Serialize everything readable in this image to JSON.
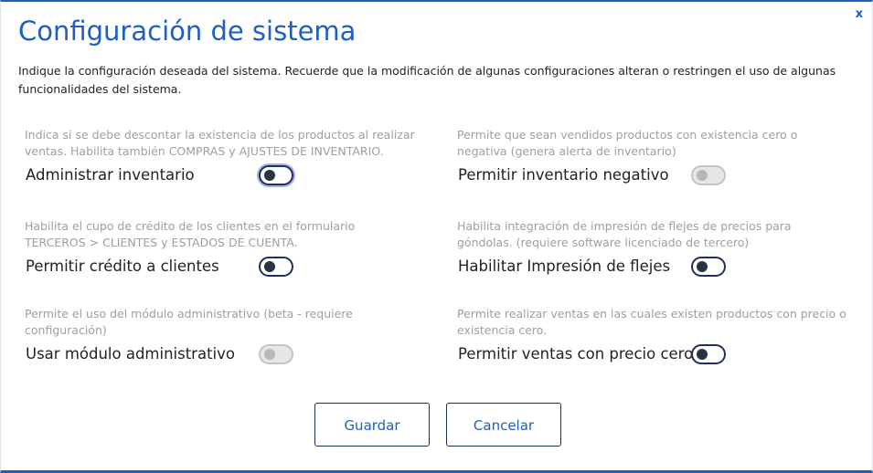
{
  "dialog": {
    "title": "Configuración de sistema",
    "close_label": "x",
    "intro": "Indique la configuración deseada del sistema. Recuerde que la modificación de algunas configuraciones alteran o restringen el uso de algunas funcionalidades del sistema."
  },
  "settings": [
    {
      "description": "Indica si se debe descontar la existencia de los productos al realizar ventas. Habilita también COMPRAS y AJUSTES DE INVENTARIO.",
      "label": "Administrar inventario",
      "state": "off",
      "enabled": true,
      "focused": true
    },
    {
      "description": "Permite que sean vendidos productos con existencia cero o negativa (genera alerta de inventario)",
      "label": "Permitir inventario negativo",
      "state": "off",
      "enabled": false
    },
    {
      "description": "Habilita el cupo de crédito de los clientes en el formulario TERCEROS > CLIENTES y ESTADOS DE CUENTA.",
      "label": "Permitir crédito a clientes",
      "state": "off",
      "enabled": true
    },
    {
      "description": "Habilita integración de impresión de flejes de precios para góndolas. (requiere software licenciado de tercero)",
      "label": "Habilitar Impresión de flejes",
      "state": "off",
      "enabled": true
    },
    {
      "description": "Permite el uso del módulo administrativo (beta - requiere configuración)",
      "label": "Usar módulo administrativo",
      "state": "off",
      "enabled": false
    },
    {
      "description": "Permite realizar ventas en las cuales existen productos con precio o existencia cero.",
      "label": "Permitir ventas con precio cero",
      "state": "off",
      "enabled": true
    }
  ],
  "actions": {
    "save_label": "Guardar",
    "cancel_label": "Cancelar"
  },
  "colors": {
    "accent": "#1f5fbf",
    "toggle_border": "#1f2f5f",
    "muted_text": "#9aa0a8",
    "disabled_toggle": "#e6e6e6"
  }
}
